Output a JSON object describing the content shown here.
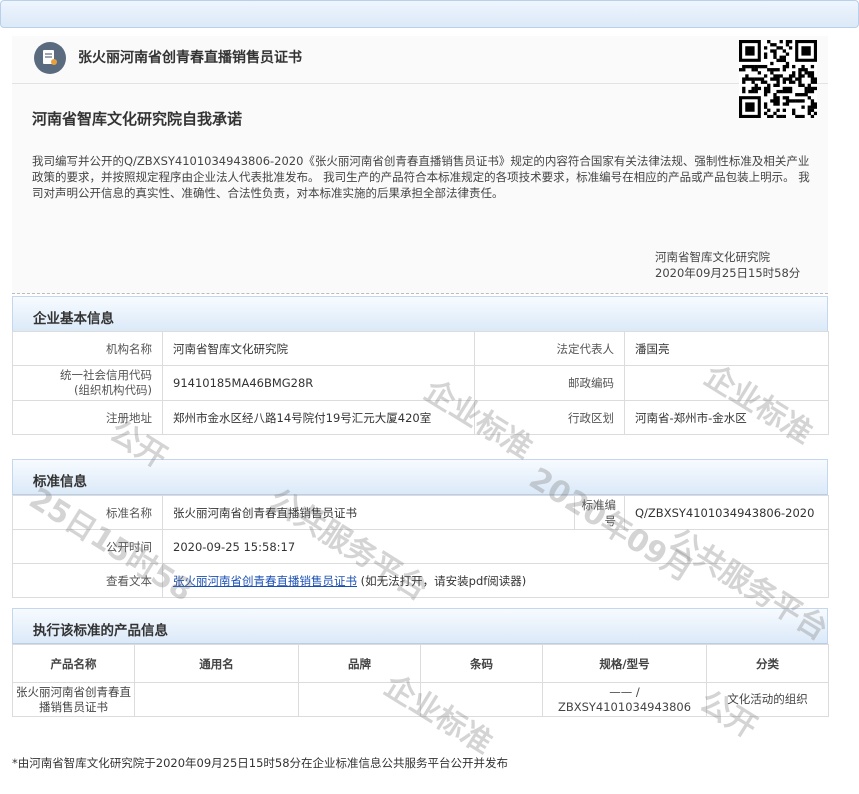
{
  "cert": {
    "title": "张火丽河南省创青春直播销售员证书"
  },
  "pledge": {
    "title": "河南省智库文化研究院自我承诺",
    "text": "我司编写并公开的Q/ZBXSY4101034943806-2020《张火丽河南省创青春直播销售员证书》规定的内容符合国家有关法律法规、强制性标准及相关产业政策的要求，并按照规定程序由企业法人代表批准发布。 我司生产的产品符合本标准规定的各项技术要求，标准编号在相应的产品或产品包装上明示。 我司对声明公开信息的真实性、准确性、合法性负责，对本标准实施的后果承担全部法律责任。",
    "sign_org": "河南省智库文化研究院",
    "sign_time": "2020年09月25日15时58分"
  },
  "company": {
    "section_title": "企业基本信息",
    "org_name_label": "机构名称",
    "org_name": "河南省智库文化研究院",
    "legal_rep_label": "法定代表人",
    "legal_rep": "潘国亮",
    "credit_code_label1": "统一社会信用代码",
    "credit_code_label2": "(组织机构代码)",
    "credit_code": "91410185MA46BMG28R",
    "postcode_label": "邮政编码",
    "postcode": "",
    "address_label": "注册地址",
    "address": "郑州市金水区经八路14号院付19号汇元大厦420室",
    "region_label": "行政区划",
    "region": "河南省-郑州市-金水区"
  },
  "standard": {
    "section_title": "标准信息",
    "name_label": "标准名称",
    "name": "张火丽河南省创青春直播销售员证书",
    "number_label": "标准编号",
    "number": "Q/ZBXSY4101034943806-2020",
    "publish_time_label": "公开时间",
    "publish_time": "2020-09-25 15:58:17",
    "view_label": "查看文本",
    "view_link": "张火丽河南省创青春直播销售员证书",
    "view_note": " (如无法打开，请安装pdf阅读器)"
  },
  "products": {
    "section_title": "执行该标准的产品信息",
    "headers": [
      "产品名称",
      "通用名",
      "品牌",
      "条码",
      "规格/型号",
      "分类"
    ],
    "rows": [
      [
        "张火丽河南省创青春直播销售员证书",
        "",
        "",
        "",
        "—— / ZBXSY4101034943806",
        "文化活动的组织"
      ]
    ]
  },
  "footer": "*由河南省智库文化研究院于2020年09月25日15时58分在企业标准信息公共服务平台公开并发布",
  "watermark": [
    "企业标准",
    "公开",
    "公共服务平台",
    "25日15时58",
    "2020年09月",
    "企业标准信息公共服务平台"
  ]
}
